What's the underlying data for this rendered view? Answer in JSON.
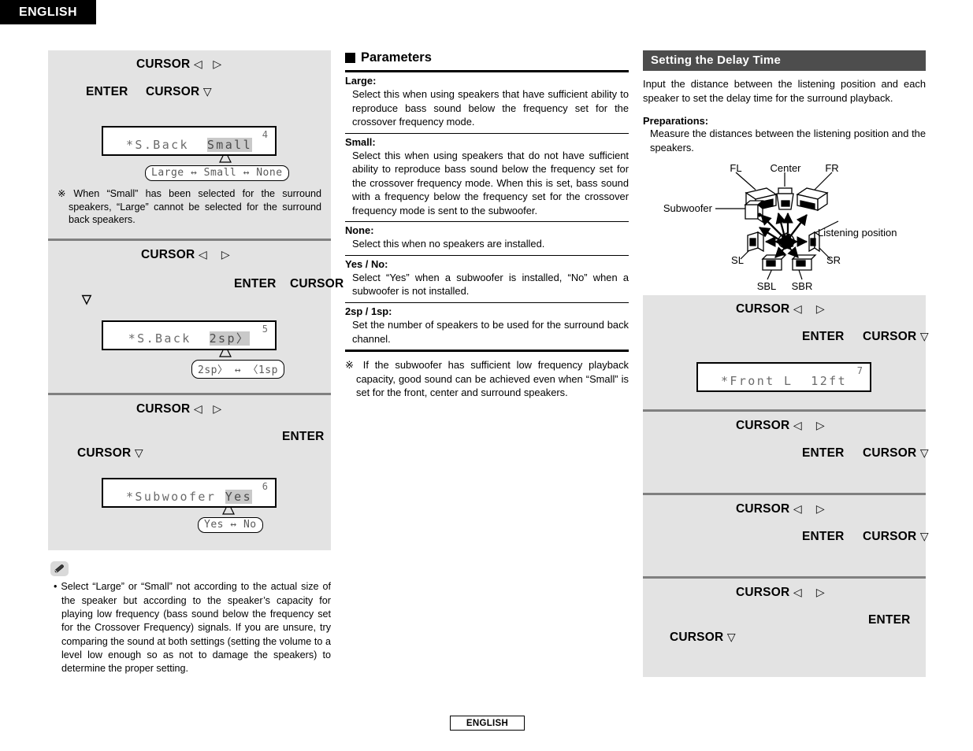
{
  "header": {
    "language_tab": "ENGLISH"
  },
  "footer": {
    "language": "ENGLISH"
  },
  "keys": {
    "cursor": "CURSOR",
    "enter": "ENTER",
    "left_tri": "◁",
    "right_tri": "▷",
    "down_tri": "▽"
  },
  "left_column": {
    "steps": [
      {
        "id": "step-4",
        "step_number": "4",
        "lcd_prefix": "*S.Back  ",
        "lcd_value": "Small",
        "options": "Large ↔ Small ↔ None",
        "note": "When “Small” has been selected for the surround speakers, “Large” cannot be selected for the surround back speakers.",
        "note_mark": "※"
      },
      {
        "id": "step-5",
        "step_number": "5",
        "lcd_prefix": "*S.Back  ",
        "lcd_value": "2sp〉",
        "options": "2sp〉 ↔ 〈1sp"
      },
      {
        "id": "step-6",
        "step_number": "6",
        "lcd_prefix": "*Subwoofer ",
        "lcd_value": "Yes",
        "options": "Yes ↔ No"
      }
    ],
    "pencil_note": "Select “Large” or “Small” not according to the actual size of the speaker but according to the speaker’s capacity for playing low frequency (bass sound below the frequency set for the Crossover Frequency) signals. If you are unsure, try comparing the sound at both settings (setting the volume to a level low enough so as not to damage the speakers) to determine the proper setting.",
    "pencil_bullet": "•"
  },
  "mid_column": {
    "title": "Parameters",
    "params": [
      {
        "term": "Large:",
        "definition": "Select this when using speakers that have sufficient ability to reproduce bass sound below the frequency set for the crossover frequency mode."
      },
      {
        "term": "Small:",
        "definition": "Select this when using speakers that do not have sufficient ability to reproduce bass sound below the frequency set for the crossover frequency mode. When this is set, bass sound with a frequency below the frequency set for the crossover frequency mode is sent to the subwoofer."
      },
      {
        "term": "None:",
        "definition": "Select this when no speakers are installed."
      },
      {
        "term": "Yes / No:",
        "definition": "Select “Yes” when a subwoofer is installed, “No” when a subwoofer is not installed."
      },
      {
        "term": "2sp / 1sp:",
        "definition": "Set the number of speakers to be used for the surround back channel."
      }
    ],
    "note_mark": "※",
    "note": "If the subwoofer has sufficient low frequency playback capacity, good sound can be achieved even when “Small” is set for the front, center and surround speakers."
  },
  "right_column": {
    "title": "Setting the Delay Time",
    "intro": "Input the distance between the listening position and each speaker to set the delay time for the surround playback.",
    "prep_term": "Preparations:",
    "prep_def": "Measure the distances between the listening position and the speakers.",
    "diagram_labels": {
      "fl": "FL",
      "center": "Center",
      "fr": "FR",
      "subwoofer": "Subwoofer",
      "listening_position": "Listening position",
      "sl": "SL",
      "sr": "SR",
      "sbl": "SBL",
      "sbr": "SBR"
    },
    "steps": [
      {
        "id": "step-7",
        "step_number": "7",
        "lcd_prefix": "*Front L  ",
        "lcd_value": "12ft"
      },
      {
        "id": "step-8"
      },
      {
        "id": "step-9"
      },
      {
        "id": "step-10"
      }
    ]
  }
}
